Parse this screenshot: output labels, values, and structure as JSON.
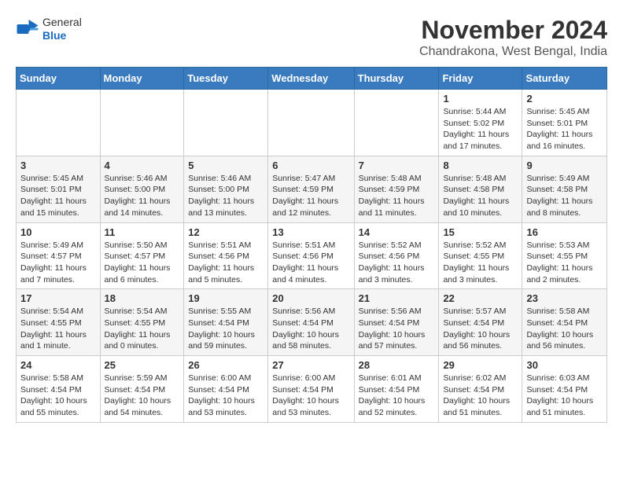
{
  "header": {
    "logo": {
      "general": "General",
      "blue": "Blue"
    },
    "title": "November 2024",
    "location": "Chandrakona, West Bengal, India"
  },
  "columns": [
    "Sunday",
    "Monday",
    "Tuesday",
    "Wednesday",
    "Thursday",
    "Friday",
    "Saturday"
  ],
  "weeks": [
    [
      null,
      null,
      null,
      null,
      null,
      {
        "day": "1",
        "sunrise": "Sunrise: 5:44 AM",
        "sunset": "Sunset: 5:02 PM",
        "daylight": "Daylight: 11 hours and 17 minutes."
      },
      {
        "day": "2",
        "sunrise": "Sunrise: 5:45 AM",
        "sunset": "Sunset: 5:01 PM",
        "daylight": "Daylight: 11 hours and 16 minutes."
      }
    ],
    [
      {
        "day": "3",
        "sunrise": "Sunrise: 5:45 AM",
        "sunset": "Sunset: 5:01 PM",
        "daylight": "Daylight: 11 hours and 15 minutes."
      },
      {
        "day": "4",
        "sunrise": "Sunrise: 5:46 AM",
        "sunset": "Sunset: 5:00 PM",
        "daylight": "Daylight: 11 hours and 14 minutes."
      },
      {
        "day": "5",
        "sunrise": "Sunrise: 5:46 AM",
        "sunset": "Sunset: 5:00 PM",
        "daylight": "Daylight: 11 hours and 13 minutes."
      },
      {
        "day": "6",
        "sunrise": "Sunrise: 5:47 AM",
        "sunset": "Sunset: 4:59 PM",
        "daylight": "Daylight: 11 hours and 12 minutes."
      },
      {
        "day": "7",
        "sunrise": "Sunrise: 5:48 AM",
        "sunset": "Sunset: 4:59 PM",
        "daylight": "Daylight: 11 hours and 11 minutes."
      },
      {
        "day": "8",
        "sunrise": "Sunrise: 5:48 AM",
        "sunset": "Sunset: 4:58 PM",
        "daylight": "Daylight: 11 hours and 10 minutes."
      },
      {
        "day": "9",
        "sunrise": "Sunrise: 5:49 AM",
        "sunset": "Sunset: 4:58 PM",
        "daylight": "Daylight: 11 hours and 8 minutes."
      }
    ],
    [
      {
        "day": "10",
        "sunrise": "Sunrise: 5:49 AM",
        "sunset": "Sunset: 4:57 PM",
        "daylight": "Daylight: 11 hours and 7 minutes."
      },
      {
        "day": "11",
        "sunrise": "Sunrise: 5:50 AM",
        "sunset": "Sunset: 4:57 PM",
        "daylight": "Daylight: 11 hours and 6 minutes."
      },
      {
        "day": "12",
        "sunrise": "Sunrise: 5:51 AM",
        "sunset": "Sunset: 4:56 PM",
        "daylight": "Daylight: 11 hours and 5 minutes."
      },
      {
        "day": "13",
        "sunrise": "Sunrise: 5:51 AM",
        "sunset": "Sunset: 4:56 PM",
        "daylight": "Daylight: 11 hours and 4 minutes."
      },
      {
        "day": "14",
        "sunrise": "Sunrise: 5:52 AM",
        "sunset": "Sunset: 4:56 PM",
        "daylight": "Daylight: 11 hours and 3 minutes."
      },
      {
        "day": "15",
        "sunrise": "Sunrise: 5:52 AM",
        "sunset": "Sunset: 4:55 PM",
        "daylight": "Daylight: 11 hours and 3 minutes."
      },
      {
        "day": "16",
        "sunrise": "Sunrise: 5:53 AM",
        "sunset": "Sunset: 4:55 PM",
        "daylight": "Daylight: 11 hours and 2 minutes."
      }
    ],
    [
      {
        "day": "17",
        "sunrise": "Sunrise: 5:54 AM",
        "sunset": "Sunset: 4:55 PM",
        "daylight": "Daylight: 11 hours and 1 minute."
      },
      {
        "day": "18",
        "sunrise": "Sunrise: 5:54 AM",
        "sunset": "Sunset: 4:55 PM",
        "daylight": "Daylight: 11 hours and 0 minutes."
      },
      {
        "day": "19",
        "sunrise": "Sunrise: 5:55 AM",
        "sunset": "Sunset: 4:54 PM",
        "daylight": "Daylight: 10 hours and 59 minutes."
      },
      {
        "day": "20",
        "sunrise": "Sunrise: 5:56 AM",
        "sunset": "Sunset: 4:54 PM",
        "daylight": "Daylight: 10 hours and 58 minutes."
      },
      {
        "day": "21",
        "sunrise": "Sunrise: 5:56 AM",
        "sunset": "Sunset: 4:54 PM",
        "daylight": "Daylight: 10 hours and 57 minutes."
      },
      {
        "day": "22",
        "sunrise": "Sunrise: 5:57 AM",
        "sunset": "Sunset: 4:54 PM",
        "daylight": "Daylight: 10 hours and 56 minutes."
      },
      {
        "day": "23",
        "sunrise": "Sunrise: 5:58 AM",
        "sunset": "Sunset: 4:54 PM",
        "daylight": "Daylight: 10 hours and 56 minutes."
      }
    ],
    [
      {
        "day": "24",
        "sunrise": "Sunrise: 5:58 AM",
        "sunset": "Sunset: 4:54 PM",
        "daylight": "Daylight: 10 hours and 55 minutes."
      },
      {
        "day": "25",
        "sunrise": "Sunrise: 5:59 AM",
        "sunset": "Sunset: 4:54 PM",
        "daylight": "Daylight: 10 hours and 54 minutes."
      },
      {
        "day": "26",
        "sunrise": "Sunrise: 6:00 AM",
        "sunset": "Sunset: 4:54 PM",
        "daylight": "Daylight: 10 hours and 53 minutes."
      },
      {
        "day": "27",
        "sunrise": "Sunrise: 6:00 AM",
        "sunset": "Sunset: 4:54 PM",
        "daylight": "Daylight: 10 hours and 53 minutes."
      },
      {
        "day": "28",
        "sunrise": "Sunrise: 6:01 AM",
        "sunset": "Sunset: 4:54 PM",
        "daylight": "Daylight: 10 hours and 52 minutes."
      },
      {
        "day": "29",
        "sunrise": "Sunrise: 6:02 AM",
        "sunset": "Sunset: 4:54 PM",
        "daylight": "Daylight: 10 hours and 51 minutes."
      },
      {
        "day": "30",
        "sunrise": "Sunrise: 6:03 AM",
        "sunset": "Sunset: 4:54 PM",
        "daylight": "Daylight: 10 hours and 51 minutes."
      }
    ]
  ]
}
